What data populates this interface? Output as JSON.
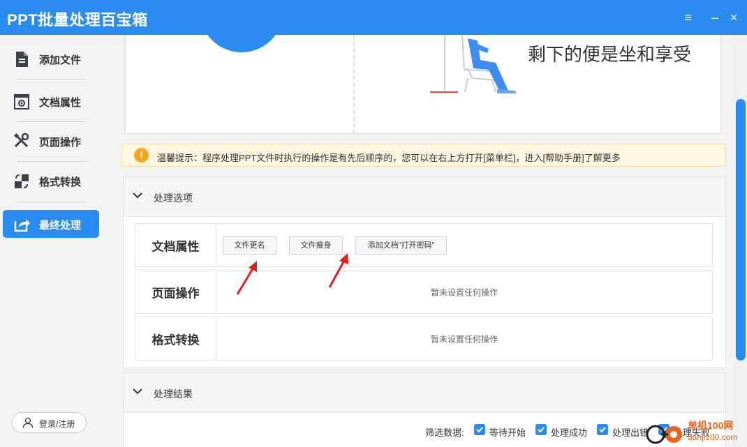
{
  "app": {
    "title": "PPT批量处理百宝箱"
  },
  "window": {
    "menu_icon": "≡",
    "minimize_icon": "–",
    "close_icon": "×"
  },
  "sidebar": {
    "items": [
      {
        "label": "添加文件",
        "icon": "file-add-icon",
        "active": false
      },
      {
        "label": "文档属性",
        "icon": "doc-settings-icon",
        "active": false
      },
      {
        "label": "页面操作",
        "icon": "tools-icon",
        "active": false
      },
      {
        "label": "格式转换",
        "icon": "convert-icon",
        "active": false
      },
      {
        "label": "最终处理",
        "icon": "share-icon",
        "active": true
      }
    ],
    "login_label": "登录/注册"
  },
  "hero": {
    "slogan": "剩下的便是坐和享受"
  },
  "tip": {
    "text": "温馨提示：程序处理PPT文件时执行的操作是有先后顺序的，您可以在右上方打开[菜单栏]，进入[帮助手册]了解更多"
  },
  "options_panel": {
    "title": "处理选项",
    "rows": [
      {
        "label": "文档属性",
        "buttons": [
          "文件更名",
          "文件瘦身",
          "添加文档\"打开密码\""
        ]
      },
      {
        "label": "页面操作",
        "empty_text": "暂未设置任何操作"
      },
      {
        "label": "格式转换",
        "empty_text": "暂未设置任何操作"
      }
    ]
  },
  "results_panel": {
    "title": "处理结果",
    "filter_label": "筛选数据:",
    "filters": [
      {
        "label": "等待开始",
        "checked": true
      },
      {
        "label": "处理成功",
        "checked": true
      },
      {
        "label": "处理出错",
        "checked": true
      },
      {
        "label": "处理失败",
        "checked": true
      }
    ]
  },
  "watermark": {
    "line1": "单机100网",
    "line2": "danji100.com"
  },
  "colors": {
    "accent": "#2a8cf0",
    "tip_bg": "#fdf6e0",
    "tip_icon": "#f5a623",
    "arrow": "#e02020"
  }
}
